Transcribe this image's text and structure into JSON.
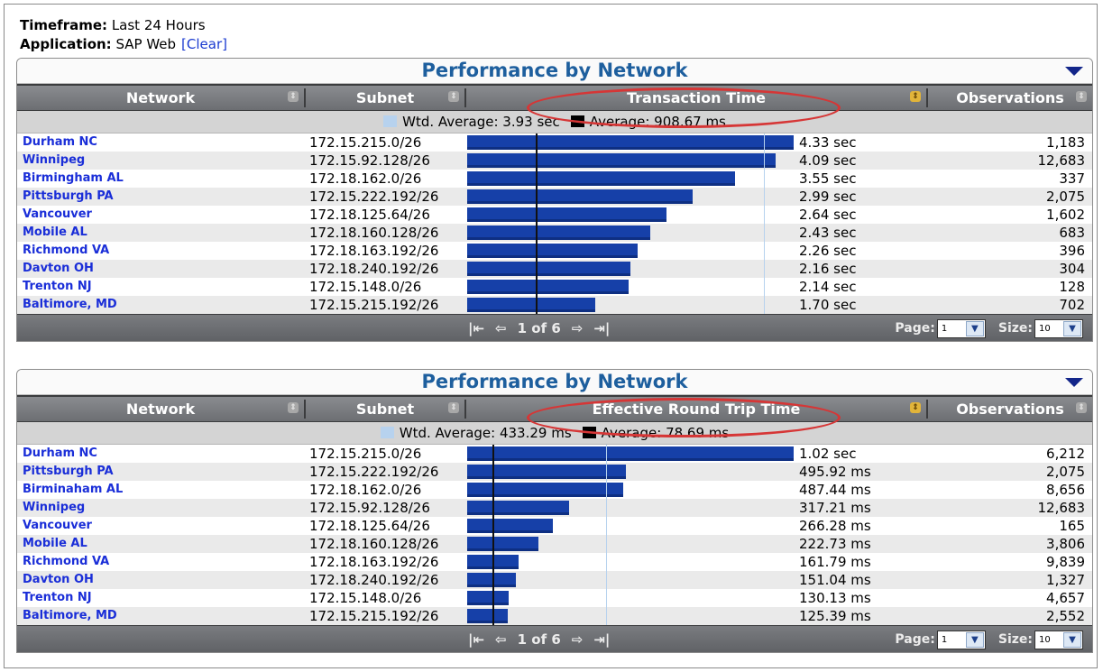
{
  "info": {
    "timeframe_label": "Timeframe:",
    "timeframe_value": "Last 24 Hours",
    "application_label": "Application:",
    "application_value": "SAP Web",
    "clear_link": "[Clear]"
  },
  "colors": {
    "bar": "#1640a8",
    "title": "#1e5f9e",
    "link": "#1a2ed8",
    "highlight_ellipse": "#d63636",
    "wtd_average_swatch": "#b7d2ee",
    "average_swatch": "#000000"
  },
  "panels": [
    {
      "title": "Performance by Network",
      "columns": [
        "Network",
        "Subnet",
        "Transaction Time",
        "Observations"
      ],
      "legend": {
        "wtd_average": "Wtd. Average: 3.93 sec",
        "average": "Average: 908.67 ms"
      },
      "bar_max": 4.33,
      "wtd_average_value": 3.93,
      "average_value": 0.90867,
      "rows": [
        {
          "network": "Durham NC",
          "subnet": "172.15.215.0/26",
          "value_text": "4.33 sec",
          "value": 4.33,
          "observations": "1,183"
        },
        {
          "network": "Winnipeg",
          "subnet": "172.15.92.128/26",
          "value_text": "4.09 sec",
          "value": 4.09,
          "observations": "12,683"
        },
        {
          "network": "Birmingham AL",
          "subnet": "172.18.162.0/26",
          "value_text": "3.55 sec",
          "value": 3.55,
          "observations": "337"
        },
        {
          "network": "Pittsburgh PA",
          "subnet": "172.15.222.192/26",
          "value_text": "2.99 sec",
          "value": 2.99,
          "observations": "2,075"
        },
        {
          "network": "Vancouver",
          "subnet": "172.18.125.64/26",
          "value_text": "2.64 sec",
          "value": 2.64,
          "observations": "1,602"
        },
        {
          "network": "Mobile AL",
          "subnet": "172.18.160.128/26",
          "value_text": "2.43 sec",
          "value": 2.43,
          "observations": "683"
        },
        {
          "network": "Richmond VA",
          "subnet": "172.18.163.192/26",
          "value_text": "2.26 sec",
          "value": 2.26,
          "observations": "396"
        },
        {
          "network": "Davton OH",
          "subnet": "172.18.240.192/26",
          "value_text": "2.16 sec",
          "value": 2.16,
          "observations": "304"
        },
        {
          "network": "Trenton NJ",
          "subnet": "172.15.148.0/26",
          "value_text": "2.14 sec",
          "value": 2.14,
          "observations": "128"
        },
        {
          "network": "Baltimore, MD",
          "subnet": "172.15.215.192/26",
          "value_text": "1.70 sec",
          "value": 1.7,
          "observations": "702"
        }
      ],
      "pager": {
        "text": "1 of 6",
        "page_label": "Page:",
        "page_value": "1",
        "size_label": "Size:",
        "size_value": "10"
      }
    },
    {
      "title": "Performance by Network",
      "columns": [
        "Network",
        "Subnet",
        "Effective Round Trip Time",
        "Observations"
      ],
      "legend": {
        "wtd_average": "Wtd. Average: 433.29 ms",
        "average": "Average: 78.69 ms"
      },
      "bar_max": 1020,
      "wtd_average_value": 433.29,
      "average_value": 78.69,
      "rows": [
        {
          "network": "Durham NC",
          "subnet": "172.15.215.0/26",
          "value_text": "1.02 sec",
          "value": 1020,
          "observations": "6,212"
        },
        {
          "network": "Pittsburgh PA",
          "subnet": "172.15.222.192/26",
          "value_text": "495.92 ms",
          "value": 495.92,
          "observations": "2,075"
        },
        {
          "network": "Birminaham AL",
          "subnet": "172.18.162.0/26",
          "value_text": "487.44 ms",
          "value": 487.44,
          "observations": "8,656"
        },
        {
          "network": "Winnipeg",
          "subnet": "172.15.92.128/26",
          "value_text": "317.21 ms",
          "value": 317.21,
          "observations": "12,683"
        },
        {
          "network": "Vancouver",
          "subnet": "172.18.125.64/26",
          "value_text": "266.28 ms",
          "value": 266.28,
          "observations": "165"
        },
        {
          "network": "Mobile AL",
          "subnet": "172.18.160.128/26",
          "value_text": "222.73 ms",
          "value": 222.73,
          "observations": "3,806"
        },
        {
          "network": "Richmond VA",
          "subnet": "172.18.163.192/26",
          "value_text": "161.79 ms",
          "value": 161.79,
          "observations": "9,839"
        },
        {
          "network": "Davton OH",
          "subnet": "172.18.240.192/26",
          "value_text": "151.04 ms",
          "value": 151.04,
          "observations": "1,327"
        },
        {
          "network": "Trenton NJ",
          "subnet": "172.15.148.0/26",
          "value_text": "130.13 ms",
          "value": 130.13,
          "observations": "4,657"
        },
        {
          "network": "Baltimore, MD",
          "subnet": "172.15.215.192/26",
          "value_text": "125.39 ms",
          "value": 125.39,
          "observations": "2,552"
        }
      ],
      "pager": {
        "text": "1 of 6",
        "page_label": "Page:",
        "page_value": "1",
        "size_label": "Size:",
        "size_value": "10"
      }
    }
  ]
}
